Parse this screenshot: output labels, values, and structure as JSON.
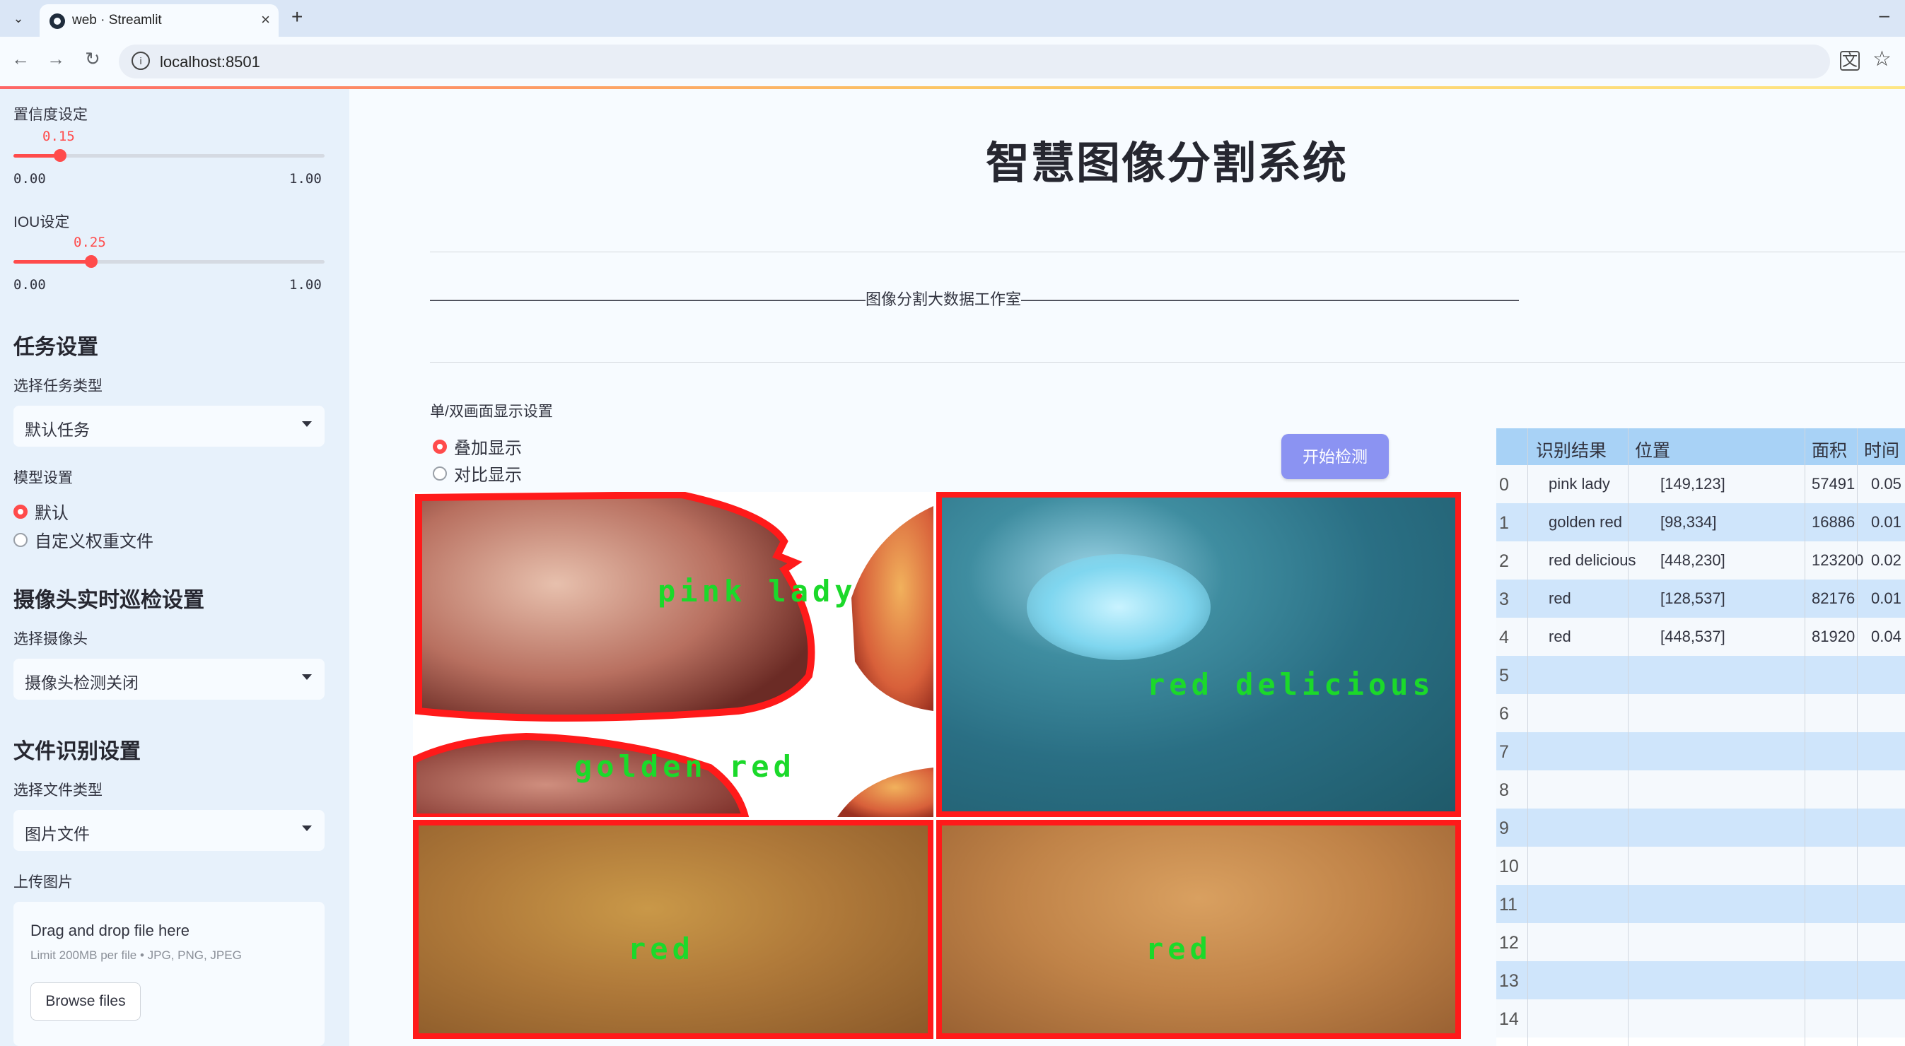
{
  "browser": {
    "tab_title": "web · Streamlit",
    "url": "localhost:8501"
  },
  "sidebar": {
    "confidence": {
      "label": "置信度设定",
      "value": "0.15",
      "min": "0.00",
      "max": "1.00",
      "fraction": 0.15
    },
    "iou": {
      "label": "IOU设定",
      "value": "0.25",
      "min": "0.00",
      "max": "1.00",
      "fraction": 0.25
    },
    "task_heading": "任务设置",
    "task_type_label": "选择任务类型",
    "task_type_value": "默认任务",
    "model_label": "模型设置",
    "model_options": [
      "默认",
      "自定义权重文件"
    ],
    "camera_heading": "摄像头实时巡检设置",
    "camera_label": "选择摄像头",
    "camera_value": "摄像头检测关闭",
    "file_heading": "文件识别设置",
    "file_type_label": "选择文件类型",
    "file_type_value": "图片文件",
    "upload_label": "上传图片",
    "upload_title": "Drag and drop file here",
    "upload_limit": "Limit 200MB per file • JPG, PNG, JPEG",
    "browse_label": "Browse files"
  },
  "main": {
    "title": "智慧图像分割系统",
    "banner": "————————————————————————————图像分割大数据工作室————————————————————————————————",
    "display_label": "单/双画面显示设置",
    "display_options": [
      "叠加显示",
      "对比显示"
    ],
    "start_button": "开始检测",
    "image_labels": [
      "pink lady",
      "golden red",
      "red delicious",
      "red",
      "red"
    ]
  },
  "table": {
    "headers": [
      "识别结果",
      "位置",
      "面积",
      "时间"
    ],
    "rows": [
      {
        "index": "0",
        "result": "pink lady",
        "position": "[149,123]",
        "area": "57491",
        "time": "0.05"
      },
      {
        "index": "1",
        "result": "golden red",
        "position": "[98,334]",
        "area": "16886",
        "time": "0.01"
      },
      {
        "index": "2",
        "result": "red delicious",
        "position": "[448,230]",
        "area": "123200",
        "time": "0.02"
      },
      {
        "index": "3",
        "result": "red",
        "position": "[128,537]",
        "area": "82176",
        "time": "0.01"
      },
      {
        "index": "4",
        "result": "red",
        "position": "[448,537]",
        "area": "81920",
        "time": "0.04"
      }
    ],
    "empty_indices": [
      "5",
      "6",
      "7",
      "8",
      "9",
      "10",
      "11",
      "12",
      "13",
      "14"
    ]
  },
  "colors": {
    "accent": "#ff4b4b",
    "button": "#8b93f2",
    "label_green": "#1bd92a",
    "mask_red": "#ff1a1a"
  }
}
